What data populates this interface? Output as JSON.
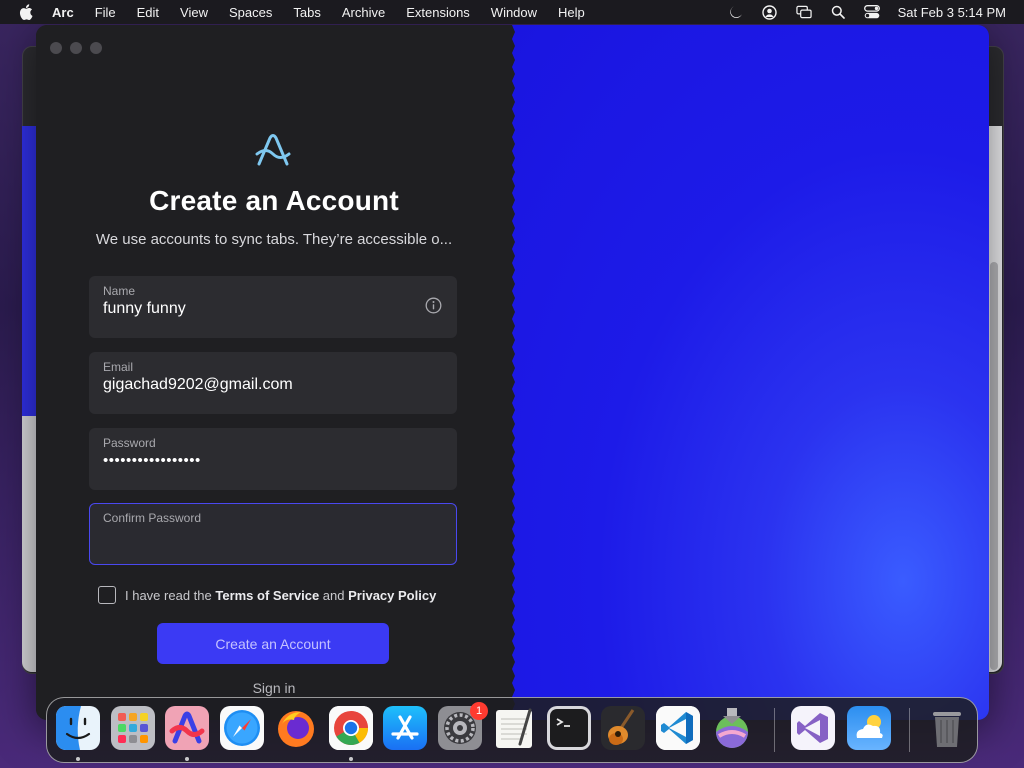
{
  "menubar": {
    "app_name": "Arc",
    "items": [
      "File",
      "Edit",
      "View",
      "Spaces",
      "Tabs",
      "Archive",
      "Extensions",
      "Window",
      "Help"
    ],
    "clock": "Sat Feb 3  5:14 PM",
    "status_icons": [
      "moon-icon",
      "user-circle-icon",
      "screen-mirroring-icon",
      "search-icon",
      "control-center-icon"
    ]
  },
  "window": {
    "title": "Create an Account",
    "subtitle": "We use accounts to sync tabs. They’re accessible o...",
    "fields": {
      "name": {
        "label": "Name",
        "value": "funny funny"
      },
      "email": {
        "label": "Email",
        "value": "gigachad9202@gmail.com"
      },
      "password": {
        "label": "Password",
        "value": "•••••••••••••••••"
      },
      "confirm_password": {
        "label": "Confirm Password",
        "value": ""
      }
    },
    "terms": {
      "prefix": "I have read the",
      "tos": "Terms of Service",
      "and": "and",
      "privacy": "Privacy Policy",
      "checked": false
    },
    "create_button": "Create an Account",
    "signin_link": "Sign in"
  },
  "colors": {
    "accent": "#3b3af4",
    "panel": "#1f1f22",
    "field": "#2c2c30",
    "focus": "#4a48f0",
    "right_pane": "#1d1be8"
  },
  "dock": {
    "apps": [
      {
        "name": "Finder",
        "icon": "finder-icon",
        "running": true
      },
      {
        "name": "Launchpad",
        "icon": "launchpad-icon",
        "running": false
      },
      {
        "name": "Arc",
        "icon": "arc-icon",
        "running": true
      },
      {
        "name": "Safari",
        "icon": "safari-icon",
        "running": false
      },
      {
        "name": "Firefox",
        "icon": "firefox-icon",
        "running": false
      },
      {
        "name": "Chrome",
        "icon": "chrome-icon",
        "running": true
      },
      {
        "name": "App Store",
        "icon": "app-store-icon",
        "running": false
      },
      {
        "name": "System Settings",
        "icon": "system-settings-icon",
        "running": false,
        "badge": "1"
      },
      {
        "name": "TextEdit",
        "icon": "textedit-icon",
        "running": false
      },
      {
        "name": "Terminal",
        "icon": "terminal-icon",
        "running": false
      },
      {
        "name": "GarageBand",
        "icon": "garageband-icon",
        "running": false
      },
      {
        "name": "Visual Studio Code",
        "icon": "vscode-icon",
        "running": false
      },
      {
        "name": "macOS Installer",
        "icon": "macos-installer-icon",
        "running": false
      },
      {
        "name": "Visual Studio",
        "icon": "visual-studio-icon",
        "running": false
      },
      {
        "name": "Weather",
        "icon": "weather-icon",
        "running": false
      },
      {
        "name": "Trash",
        "icon": "trash-icon",
        "running": false
      }
    ]
  }
}
